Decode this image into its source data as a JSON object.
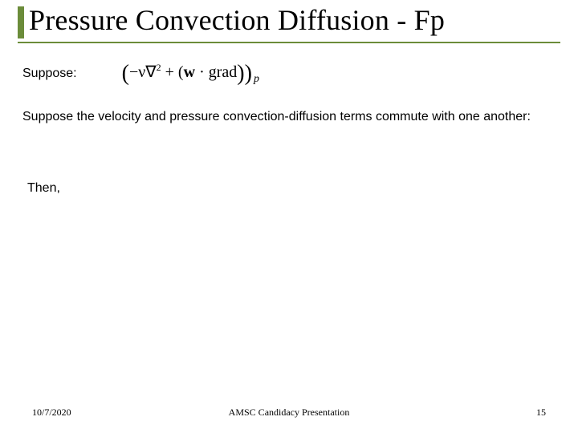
{
  "title": "Pressure Convection Diffusion - Fp",
  "suppose_label": "Suppose:",
  "formula": {
    "lparen": "(",
    "neg_nu": "−ν",
    "nabla": "∇",
    "sq": "2",
    "plus": " + (",
    "w": "w",
    "dot": " · ",
    "grad": "grad",
    "rr": "))",
    "sub_p": "p"
  },
  "commute_para": "Suppose the velocity and pressure convection-diffusion terms commute with one another:",
  "then_label": "Then,",
  "footer": {
    "date": "10/7/2020",
    "center": "AMSC Candidacy Presentation",
    "page": "15"
  }
}
